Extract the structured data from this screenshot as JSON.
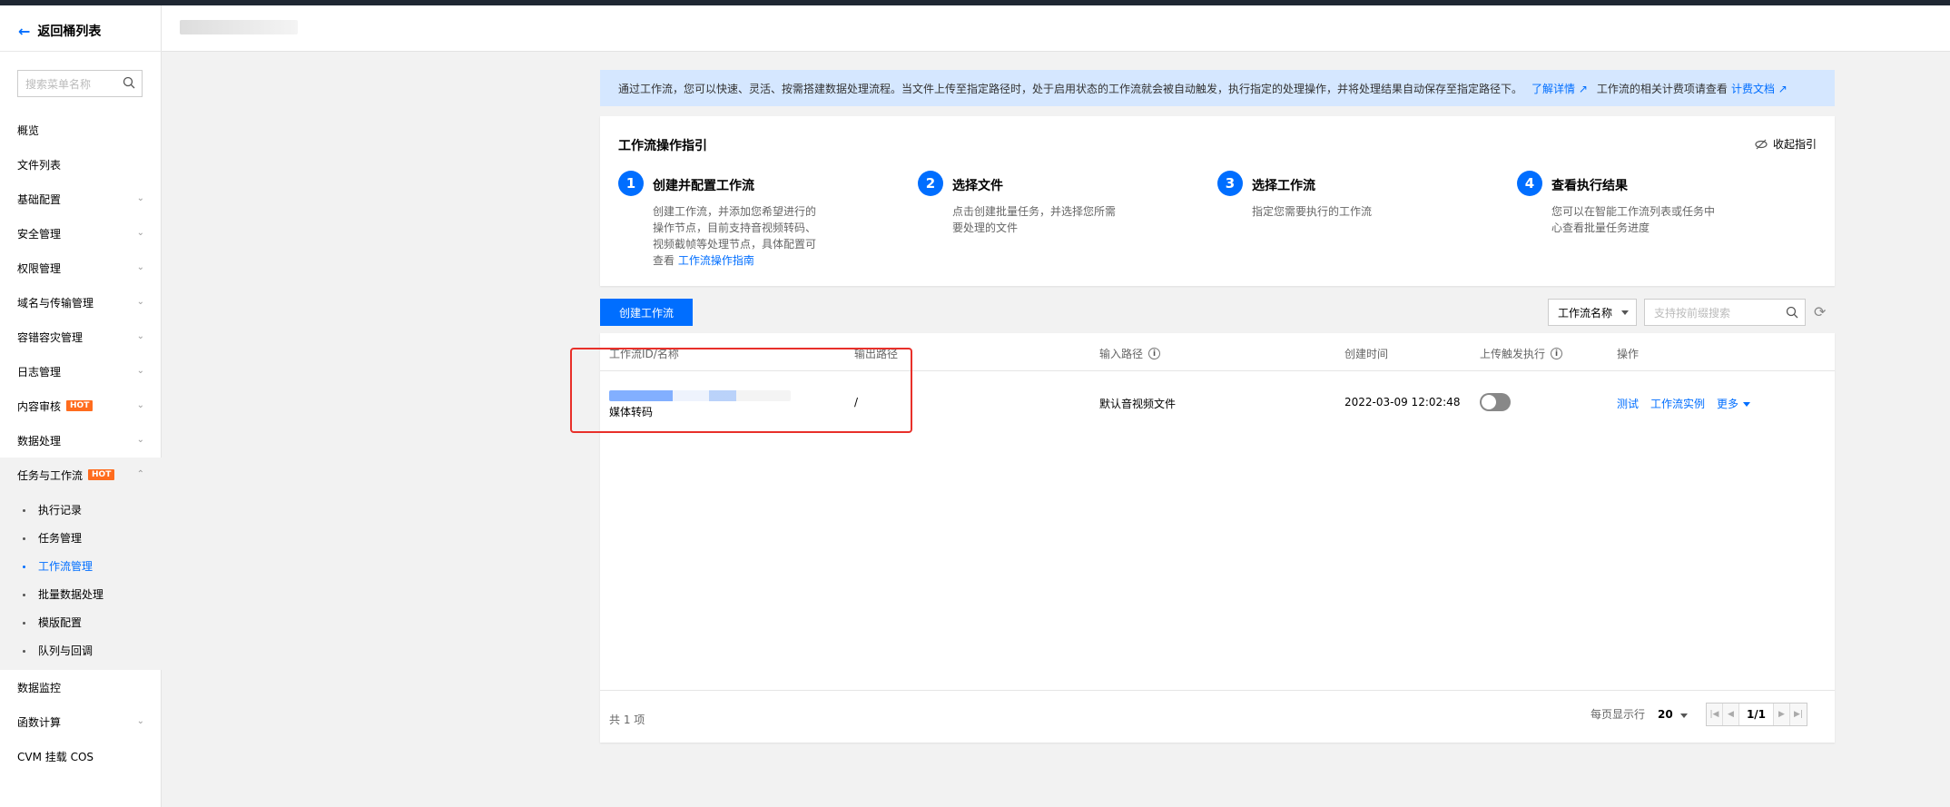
{
  "sidebar": {
    "back_label": "返回桶列表",
    "search_placeholder": "搜索菜单名称",
    "items": [
      {
        "label": "概览"
      },
      {
        "label": "文件列表"
      },
      {
        "label": "基础配置"
      },
      {
        "label": "安全管理"
      },
      {
        "label": "权限管理"
      },
      {
        "label": "域名与传输管理"
      },
      {
        "label": "容错容灾管理"
      },
      {
        "label": "日志管理"
      },
      {
        "label": "内容审核",
        "badge": "HOT"
      },
      {
        "label": "数据处理"
      },
      {
        "label": "任务与工作流",
        "badge": "HOT"
      }
    ],
    "sub_items": [
      {
        "label": "执行记录"
      },
      {
        "label": "任务管理"
      },
      {
        "label": "工作流管理"
      },
      {
        "label": "批量数据处理"
      },
      {
        "label": "模版配置"
      },
      {
        "label": "队列与回调"
      }
    ],
    "bottom_items": [
      {
        "label": "数据监控"
      },
      {
        "label": "函数计算"
      },
      {
        "label": "CVM 挂载 COS"
      }
    ]
  },
  "notice": {
    "text": "通过工作流，您可以快速、灵活、按需搭建数据处理流程。当文件上传至指定路径时，处于启用状态的工作流就会被自动触发，执行指定的处理操作，并将处理结果自动保存至指定路径下。",
    "link1": "了解详情",
    "text2": "工作流的相关计费项请查看",
    "link2": "计费文档"
  },
  "guide": {
    "title": "工作流操作指引",
    "collapse_label": "收起指引",
    "steps": [
      {
        "num": "1",
        "title": "创建并配置工作流",
        "desc": "创建工作流，并添加您希望进行的操作节点，目前支持音视频转码、视频截帧等处理节点，具体配置可查看",
        "link": "工作流操作指南"
      },
      {
        "num": "2",
        "title": "选择文件",
        "desc": "点击创建批量任务，并选择您所需要处理的文件"
      },
      {
        "num": "3",
        "title": "选择工作流",
        "desc": "指定您需要执行的工作流"
      },
      {
        "num": "4",
        "title": "查看执行结果",
        "desc": "您可以在智能工作流列表或任务中心查看批量任务进度"
      }
    ]
  },
  "toolbar": {
    "create_label": "创建工作流",
    "filter_value": "工作流名称",
    "search_placeholder": "支持按前缀搜索"
  },
  "table": {
    "headers": {
      "id_name": "工作流ID/名称",
      "output_path": "输出路径",
      "input_path": "输入路径",
      "created": "创建时间",
      "trigger": "上传触发执行",
      "actions": "操作"
    },
    "rows": [
      {
        "name": "媒体转码",
        "output_path": "/",
        "input_path": "默认音视频文件",
        "created": "2022-03-09 12:02:48",
        "trigger_on": false,
        "actions": [
          "测试",
          "工作流实例",
          "更多"
        ]
      }
    ],
    "footer": {
      "total": "共 1 项",
      "per_page_label": "每页显示行",
      "per_page_value": "20",
      "page": "1/1"
    }
  },
  "colors": {
    "primary": "#006eff",
    "notice_bg": "#d5e7ff",
    "hot": "#ff6c1e",
    "annotation": "#e8302a"
  }
}
